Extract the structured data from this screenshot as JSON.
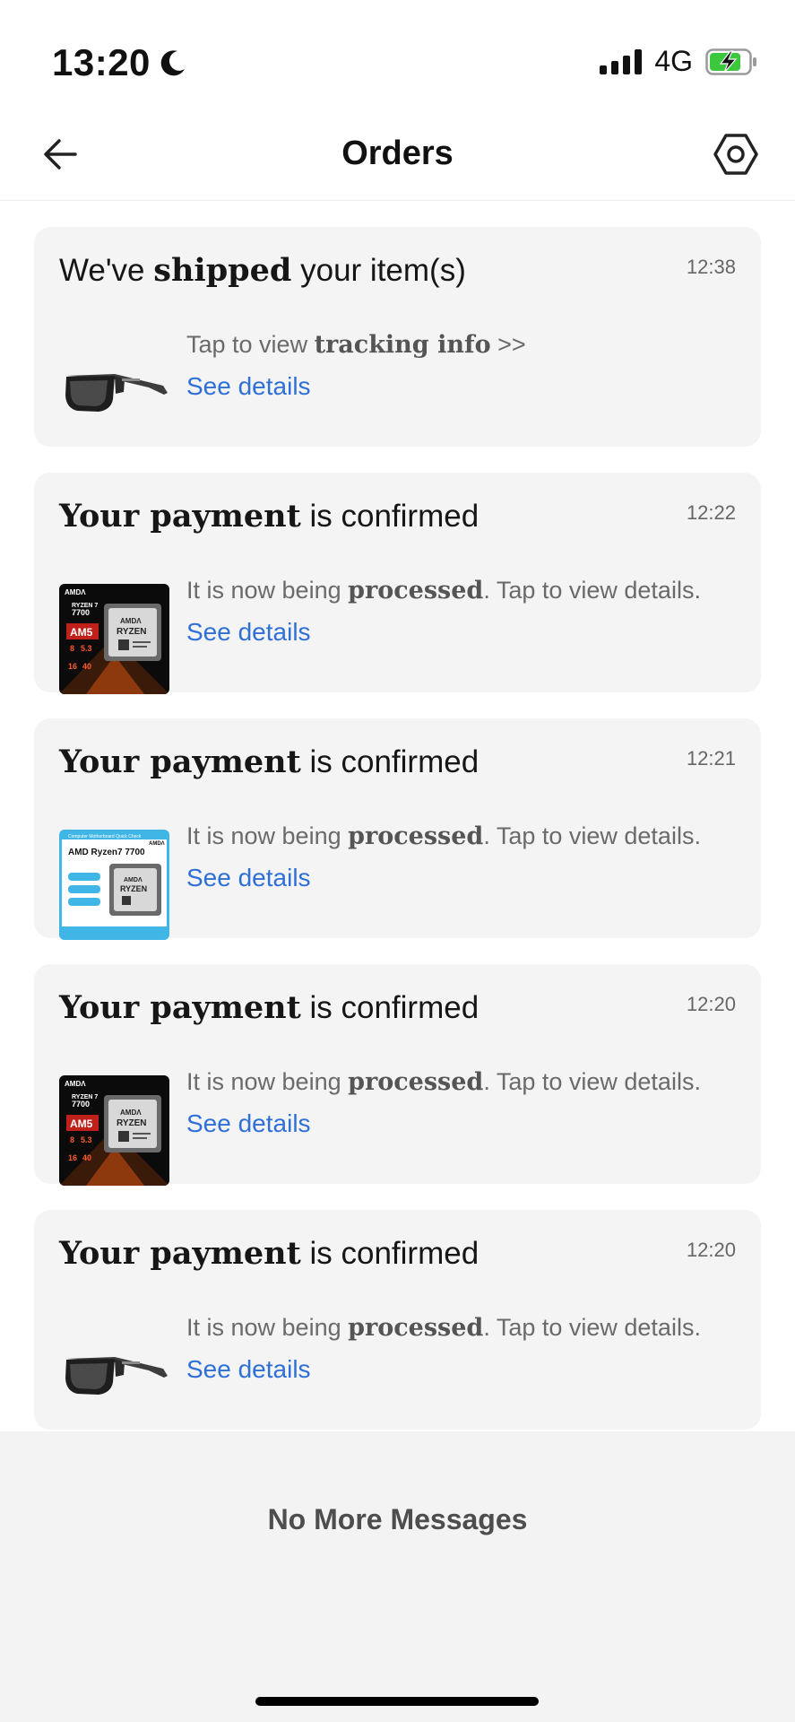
{
  "status_bar": {
    "time": "13:20",
    "network": "4G",
    "moon_icon": "moon-icon",
    "signal_icon": "cellular-signal-icon",
    "battery_icon": "battery-charging-icon"
  },
  "nav": {
    "title": "Orders",
    "back_icon": "back-arrow-icon",
    "settings_icon": "settings-hexagon-icon"
  },
  "cards": [
    {
      "title_pre": "We've ",
      "title_bold": "shipped",
      "title_post": " your item(s)",
      "time": "12:38",
      "desc_pre": "Tap to view ",
      "desc_bold": "tracking info",
      "desc_post": " >>",
      "link": "See details",
      "thumb": "sunglasses"
    },
    {
      "title_pre": "",
      "title_bold": "Your payment",
      "title_post": " is confirmed",
      "time": "12:22",
      "desc_pre": "It is now being ",
      "desc_bold": "processed",
      "desc_post": ". Tap to view details.",
      "link": "See details",
      "thumb": "amd-dark"
    },
    {
      "title_pre": "",
      "title_bold": "Your payment",
      "title_post": " is confirmed",
      "time": "12:21",
      "desc_pre": "It is now being ",
      "desc_bold": "processed",
      "desc_post": ". Tap to view details.",
      "link": "See details",
      "thumb": "amd-light"
    },
    {
      "title_pre": "",
      "title_bold": "Your payment",
      "title_post": " is confirmed",
      "time": "12:20",
      "desc_pre": "It is now being ",
      "desc_bold": "processed",
      "desc_post": ". Tap to view details.",
      "link": "See details",
      "thumb": "amd-dark"
    },
    {
      "title_pre": "",
      "title_bold": "Your payment",
      "title_post": " is confirmed",
      "time": "12:20",
      "desc_pre": "It is now being ",
      "desc_bold": "processed",
      "desc_post": ". Tap to view details.",
      "link": "See details",
      "thumb": "sunglasses"
    }
  ],
  "thumb_text": {
    "amd_dark": {
      "brand": "AMDΛ",
      "model_line1": "RYZEN 7",
      "model_line2": "7700",
      "socket": "AM5",
      "cores": "8",
      "boost": "5.3",
      "threads": "16",
      "cache": "40",
      "chip_brand": "AMDΛ",
      "chip_name": "RYZEN"
    },
    "amd_light": {
      "banner": "Computer Motherboard Quick Check",
      "brand": "AMDΛ",
      "title": "AMD Ryzen7 7700",
      "chip_brand": "AMDΛ",
      "chip_name": "RYZEN"
    }
  },
  "footer": {
    "no_more": "No More Messages"
  },
  "colors": {
    "link": "#2f6fd8",
    "card_bg": "#f4f4f4",
    "footer_bg": "#f3f3f3",
    "battery_charge": "#3cc83c"
  }
}
